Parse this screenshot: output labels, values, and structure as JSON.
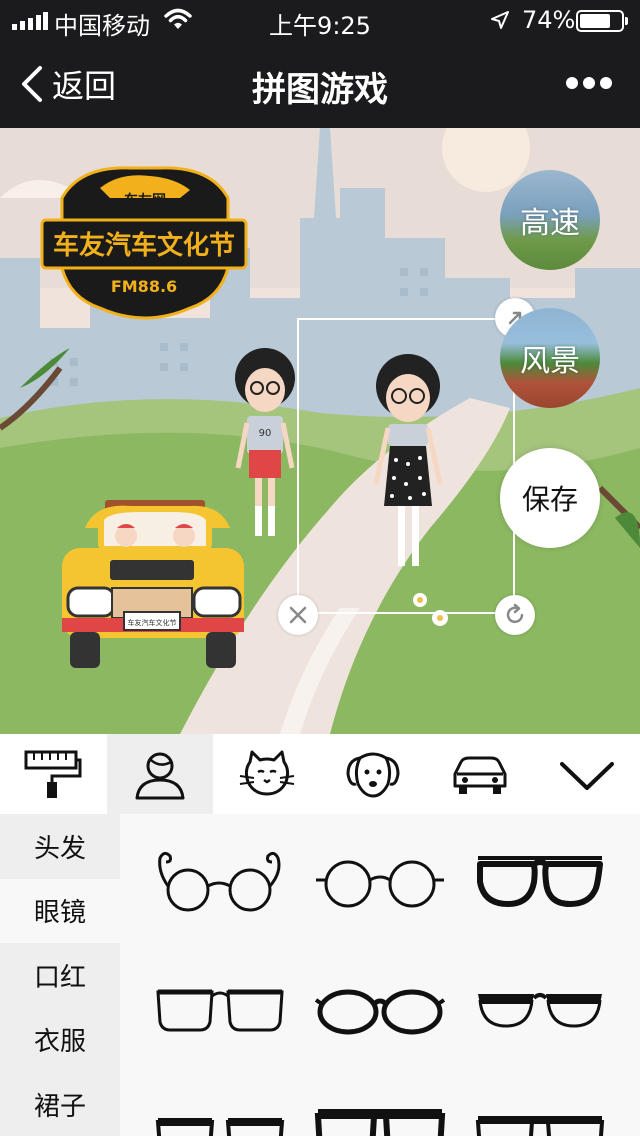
{
  "status_bar": {
    "carrier": "中国移动",
    "time": "上午9:25",
    "battery_percent": "74%",
    "battery_level": 0.74
  },
  "nav": {
    "back_label": "返回",
    "title": "拼图游戏"
  },
  "canvas": {
    "logo_top_text": "车友网",
    "logo_main_text": "车友汽车文化节",
    "logo_sub_text": "FM88.6",
    "plate_text": "车友汽车文化节",
    "shirt_number": "90",
    "bubbles": {
      "highway_label": "高速",
      "scenery_label": "风景",
      "save_label": "保存"
    }
  },
  "tabs": [
    {
      "name": "paint-roller-icon",
      "active": false
    },
    {
      "name": "person-icon",
      "active": true
    },
    {
      "name": "cat-icon",
      "active": false
    },
    {
      "name": "dog-icon",
      "active": false
    },
    {
      "name": "car-icon",
      "active": false
    },
    {
      "name": "chevron-down-icon",
      "active": false
    }
  ],
  "categories": [
    {
      "label": "头发",
      "active": false
    },
    {
      "label": "眼镜",
      "active": true
    },
    {
      "label": "口红",
      "active": false
    },
    {
      "label": "衣服",
      "active": false
    },
    {
      "label": "裙子",
      "active": false
    }
  ],
  "items": [
    {
      "name": "glasses-curly-round"
    },
    {
      "name": "glasses-round-thin"
    },
    {
      "name": "glasses-aviator-bold"
    },
    {
      "name": "glasses-square-thin"
    },
    {
      "name": "glasses-oval-bold"
    },
    {
      "name": "glasses-browline"
    },
    {
      "name": "glasses-partial-1"
    },
    {
      "name": "glasses-partial-2"
    },
    {
      "name": "glasses-partial-3"
    }
  ],
  "colors": {
    "bar_bg": "#1b1b1d",
    "logo_gold": "#f2b11b",
    "car_yellow": "#f4c431",
    "grass_green": "#8cb862"
  }
}
